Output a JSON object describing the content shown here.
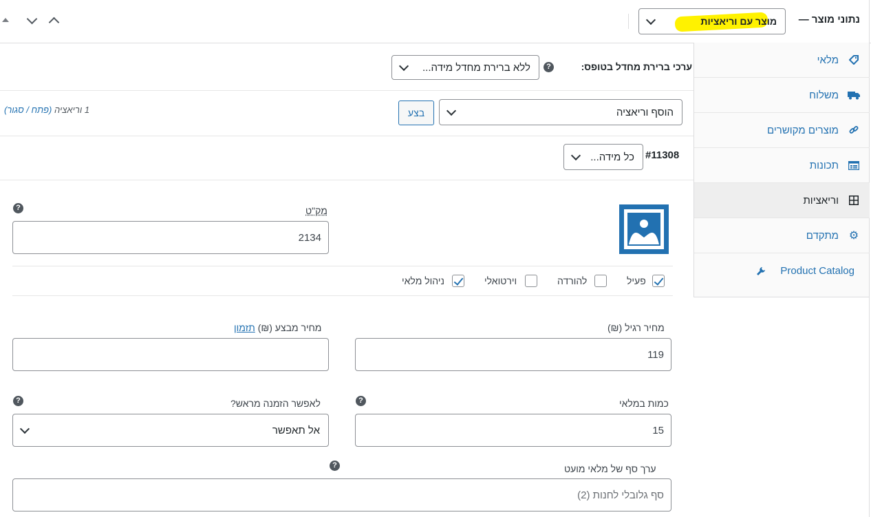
{
  "header": {
    "title": "נתוני מוצר —",
    "product_type": "מוצר עם וריאציות"
  },
  "sidebar": {
    "items": [
      {
        "label": "מלאי",
        "icon": "tag-icon"
      },
      {
        "label": "משלוח",
        "icon": "truck-icon"
      },
      {
        "label": "מוצרים מקושרים",
        "icon": "link-icon"
      },
      {
        "label": "תכונות",
        "icon": "list-icon"
      },
      {
        "label": "וריאציות",
        "icon": "grid-icon"
      },
      {
        "label": "מתקדם",
        "icon": "gear-icon"
      },
      {
        "label": "Product Catalog",
        "icon": "wrench-icon"
      }
    ]
  },
  "defaults": {
    "label": "ערכי ברירת מחדל בטופס:",
    "select_value": "ללא ברירת מחדל מידה..."
  },
  "actions": {
    "select_value": "הוסף וריאציה",
    "go_button": "בצע",
    "count_text": "1 וריאציה",
    "expand_text": "(פתח / סגור)"
  },
  "variation": {
    "id": "#11308",
    "attribute_select": "כל מידה...",
    "sku_label": "מק\"ט",
    "sku_value": "2134",
    "checkboxes": {
      "enabled": "פעיל",
      "downloadable": "להורדה",
      "virtual": "וירטואלי",
      "manage_stock": "ניהול מלאי"
    },
    "regular_price_label": "מחיר רגיל (₪)",
    "regular_price_value": "119",
    "sale_price_label": "מחיר מבצע (₪)",
    "schedule_link": "תזמון",
    "stock_qty_label": "כמות במלאי",
    "stock_qty_value": "15",
    "backorders_label": "לאפשר הזמנה מראש?",
    "backorders_value": "אל תאפשר",
    "low_stock_label": "ערך סף של מלאי מועט",
    "low_stock_placeholder": "סף גלובלי לחנות (2)"
  },
  "colors": {
    "accent": "#2271b1",
    "highlight": "#fff200",
    "image_blue": "#2271b1"
  }
}
